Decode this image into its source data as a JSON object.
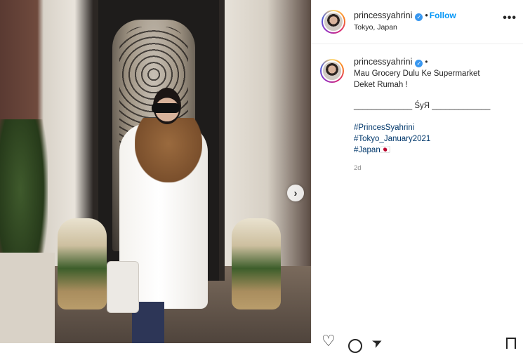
{
  "post": {
    "username": "princessyahrini",
    "follow_label": "Follow",
    "location": "Tokyo, Japan",
    "more_label": "•••"
  },
  "caption": {
    "username": "princessyahrini",
    "lines": [
      "Mau Grocery Dulu Ke Supermarket",
      "Deket Rumah !"
    ],
    "signature": "_____________ ŚyЯ _____________",
    "hashtags": [
      "#PrincesSyahrini",
      "#Tokyo_January2021",
      "#Japan🇯🇵"
    ],
    "time": "2d"
  },
  "icons": {
    "verified": "verified-badge-icon",
    "next": "chevron-right-icon",
    "like": "heart-icon",
    "comment": "comment-icon",
    "share": "paper-plane-icon",
    "save": "bookmark-icon"
  },
  "colors": {
    "link": "#0095f6",
    "hashtag": "#00376b",
    "verified": "#3897f0",
    "muted": "#8e8e8e"
  }
}
